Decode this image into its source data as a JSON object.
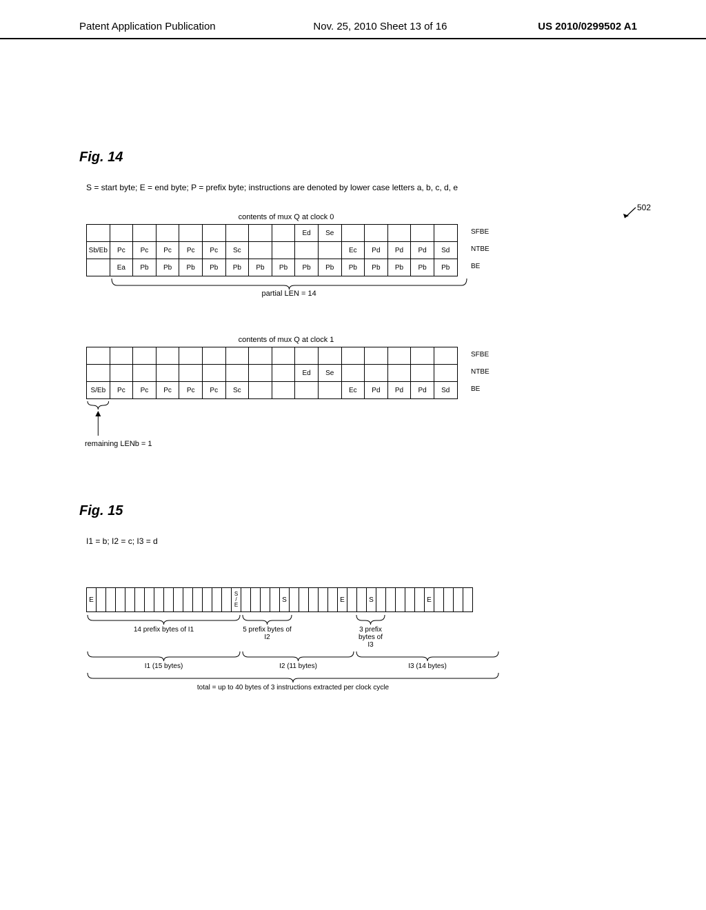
{
  "header": {
    "left": "Patent Application Publication",
    "mid": "Nov. 25, 2010  Sheet 13 of 16",
    "right": "US 2010/0299502 A1"
  },
  "ref502": "502",
  "fig14": {
    "title": "Fig. 14",
    "legend": "S = start byte;  E = end byte;  P = prefix byte; instructions are denoted by lower case letters a, b, c, d, e",
    "tables": [
      {
        "caption": "contents of mux Q at clock 0",
        "labels": [
          "SFBE",
          "NTBE",
          "BE"
        ],
        "rows": [
          [
            "",
            "",
            "",
            "",
            "",
            "",
            "",
            "",
            "",
            "Ed",
            "Se",
            "",
            "",
            "",
            "",
            ""
          ],
          [
            "Sb/Eb",
            "Pc",
            "Pc",
            "Pc",
            "Pc",
            "Pc",
            "Sc",
            "",
            "",
            "",
            "",
            "Ec",
            "Pd",
            "Pd",
            "Pd",
            "Sd"
          ],
          [
            "",
            "Ea",
            "Pb",
            "Pb",
            "Pb",
            "Pb",
            "Pb",
            "Pb",
            "Pb",
            "Pb",
            "Pb",
            "Pb",
            "Pb",
            "Pb",
            "Pb",
            "Pb"
          ]
        ],
        "brace_label": "partial LEN = 14",
        "brace_from": 1,
        "brace_to": 15
      },
      {
        "caption": "contents of mux Q at clock 1",
        "labels": [
          "SFBE",
          "NTBE",
          "BE"
        ],
        "rows": [
          [
            "",
            "",
            "",
            "",
            "",
            "",
            "",
            "",
            "",
            "",
            "",
            "",
            "",
            "",
            "",
            ""
          ],
          [
            "",
            "",
            "",
            "",
            "",
            "",
            "",
            "",
            "",
            "Ed",
            "Se",
            "",
            "",
            "",
            "",
            ""
          ],
          [
            "S/Eb",
            "Pc",
            "Pc",
            "Pc",
            "Pc",
            "Pc",
            "Sc",
            "",
            "",
            "",
            "",
            "Ec",
            "Pd",
            "Pd",
            "Pd",
            "Sd"
          ]
        ],
        "brace_label": "remaining LENb = 1",
        "brace_from": 0,
        "brace_to": 0
      }
    ]
  },
  "fig15": {
    "title": "Fig. 15",
    "legend": "I1 = b;  I2 = c; I3 = d",
    "bytes_count": 40,
    "markers": {
      "0": "E",
      "15": "S / E",
      "20": "S",
      "26": "E",
      "29": "S",
      "35": "E"
    },
    "prefix_braces": [
      {
        "start": 0,
        "end": 14,
        "label": "14 prefix bytes of I1"
      },
      {
        "start": 15,
        "end": 19,
        "label": "5 prefix bytes of I2"
      },
      {
        "start": 26,
        "end": 28,
        "label": "3 prefix bytes of I3"
      }
    ],
    "instr_braces": [
      {
        "start": 0,
        "end": 14,
        "label": "I1 (15 bytes)"
      },
      {
        "start": 15,
        "end": 25,
        "label": "I2 (11 bytes)"
      },
      {
        "start": 26,
        "end": 39,
        "label": "I3 (14 bytes)"
      }
    ],
    "total_label": "total = up to 40 bytes of 3 instructions extracted per clock cycle"
  }
}
